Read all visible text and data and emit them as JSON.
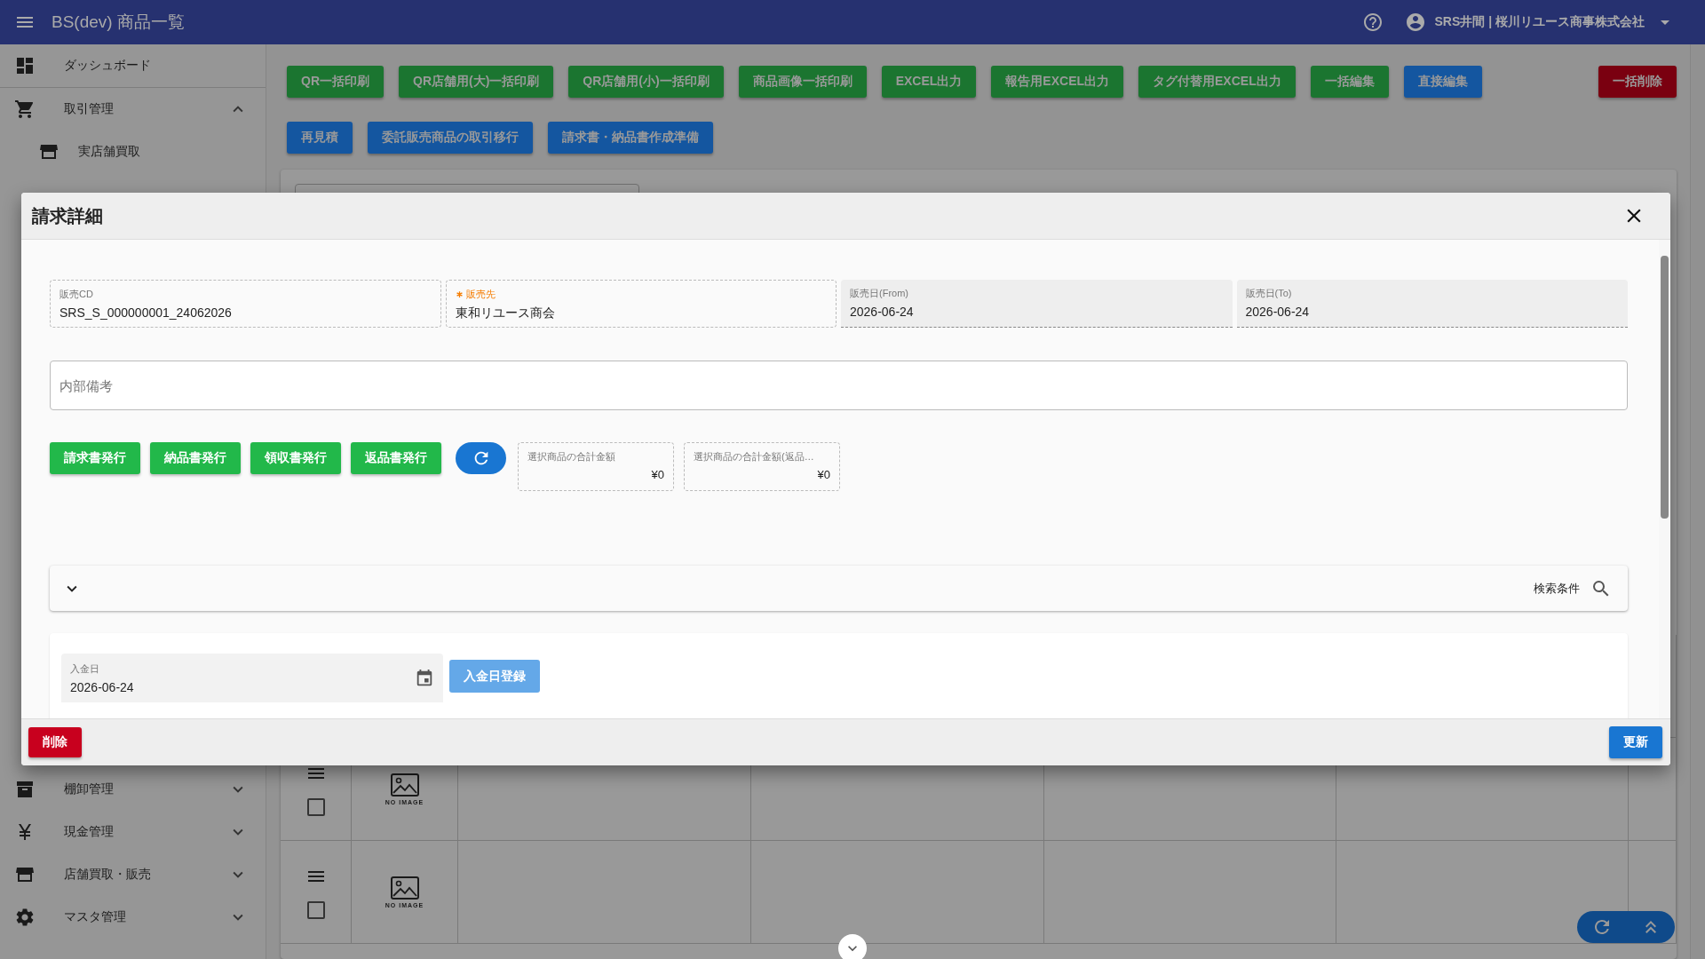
{
  "app_bar": {
    "title": "BS(dev) 商品一覧",
    "user": "SRS井間 | 桜川リユース商事株式会社"
  },
  "sidebar": {
    "items": [
      {
        "label": "ダッシュボード"
      },
      {
        "label": "取引管理",
        "expanded": true,
        "children": [
          {
            "label": "実店舗買取"
          }
        ]
      },
      {
        "label": "棚卸管理",
        "expanded": false
      },
      {
        "label": "現金管理",
        "expanded": false
      },
      {
        "label": "店舗買取・販売",
        "expanded": false
      },
      {
        "label": "マスタ管理",
        "expanded": false
      }
    ]
  },
  "toolbar": {
    "rows": [
      {
        "buttons": [
          {
            "label": "QR一括印刷",
            "color": "#1b7530"
          },
          {
            "label": "QR店舗用(大)一括印刷",
            "color": "#1b7530"
          },
          {
            "label": "QR店舗用(小)一括印刷",
            "color": "#1b7530"
          },
          {
            "label": "商品画像一括印刷",
            "color": "#1b7530"
          },
          {
            "label": "EXCEL出力",
            "color": "#1b7530"
          },
          {
            "label": "報告用EXCEL出力",
            "color": "#1b7530"
          },
          {
            "label": "タグ付替用EXCEL出力",
            "color": "#1b7530"
          },
          {
            "label": "一括編集",
            "color": "#1b7530"
          },
          {
            "label": "直接編集",
            "color": "#1456a0"
          }
        ],
        "end_buttons": [
          {
            "label": "一括削除",
            "color": "#7a0010"
          }
        ]
      },
      {
        "buttons": [
          {
            "label": "再見積",
            "color": "#1456a0"
          },
          {
            "label": "委託販売商品の取引移行",
            "color": "#1456a0"
          },
          {
            "label": "請求書・納品書作成準備",
            "color": "#1456a0"
          }
        ]
      }
    ]
  },
  "table": {
    "rows": [
      {
        "checked": false,
        "image_label": "NO IMAGE"
      },
      {
        "checked": false,
        "image_label": "NO IMAGE"
      }
    ]
  },
  "modal": {
    "title": "請求詳細",
    "fields": [
      {
        "label": "販売CD",
        "value": "SRS_S_000000001_24062026",
        "kind": "readonly",
        "required": false
      },
      {
        "label": "販売先",
        "value": "東和リユース商会",
        "kind": "readonly",
        "required": true
      },
      {
        "label": "販売日(From)",
        "value": "2026-06-24",
        "kind": "disabled",
        "required": false
      },
      {
        "label": "販売日(To)",
        "value": "2026-06-24",
        "kind": "disabled",
        "required": false
      }
    ],
    "memo": {
      "placeholder": "内部備考"
    },
    "actions": [
      {
        "label": "請求書発行"
      },
      {
        "label": "納品書発行"
      },
      {
        "label": "領収書発行"
      },
      {
        "label": "返品書発行"
      }
    ],
    "totals": [
      {
        "label": "選択商品の合計金額",
        "value": "¥0"
      },
      {
        "label": "選択商品の合計金額(返品…",
        "value": "¥0"
      }
    ],
    "search_panel": {
      "label": "検索条件",
      "expanded": false
    },
    "payment": {
      "date_label": "入金日",
      "date": "2026-06-24",
      "button": {
        "label": "入金日登録",
        "disabled": true
      }
    },
    "footer": {
      "delete": "削除",
      "update": "更新"
    }
  }
}
